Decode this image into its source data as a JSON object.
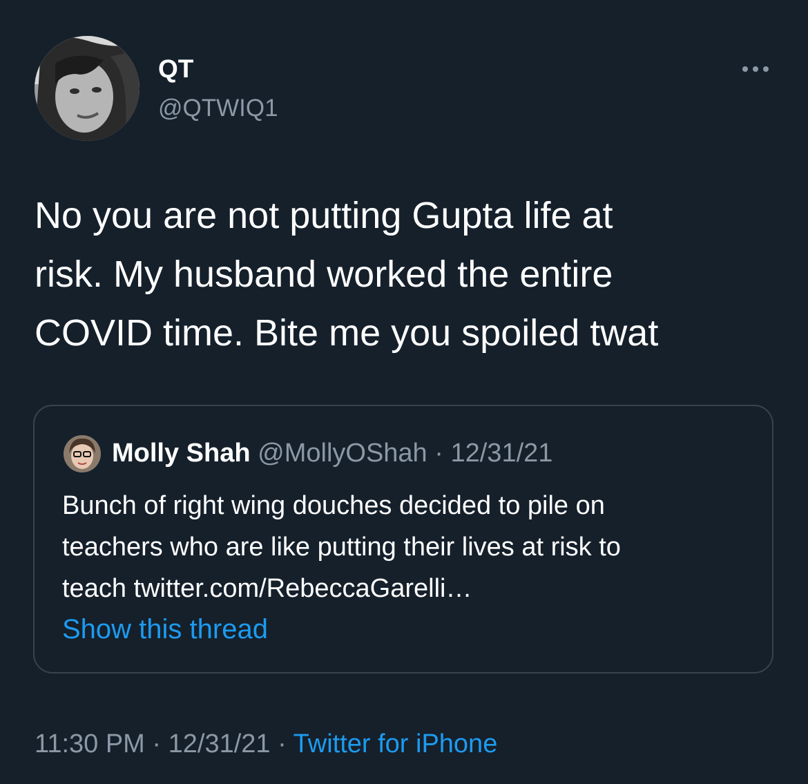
{
  "tweet": {
    "author": {
      "display_name": "QT",
      "handle": "@QTWIQ1",
      "avatar_icon": "profile-photo"
    },
    "more_icon": "ellipsis-icon",
    "text": "No you are not putting Gupta life at\nrisk. My husband worked the entire\nCOVID time. Bite me you spoiled twat",
    "quoted_tweet": {
      "display_name": "Molly Shah",
      "handle": "@MollyOShah",
      "separator": "·",
      "date": "12/31/21",
      "text": "Bunch of right wing douches decided to pile on\nteachers who are like putting their lives at risk to\nteach twitter.com/RebeccaGarelli…",
      "show_thread_label": "Show this thread"
    },
    "footer": {
      "time": "11:30 PM",
      "separator": "·",
      "date": "12/31/21",
      "source": "Twitter for iPhone"
    }
  },
  "colors": {
    "background": "#15202b",
    "text": "#ffffff",
    "secondary_text": "#8b98a5",
    "link": "#1d9bf0",
    "border": "#38444d"
  }
}
